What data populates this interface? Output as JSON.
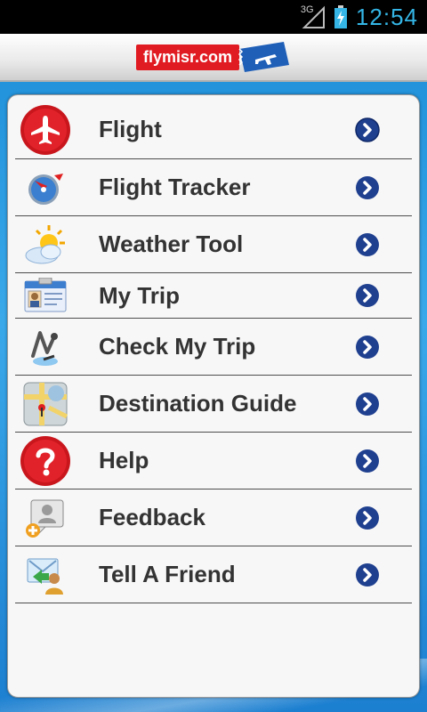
{
  "status_bar": {
    "network": "3G",
    "time": "12:54"
  },
  "header": {
    "logo_text": "flymisr.com"
  },
  "menu": {
    "items": [
      {
        "label": "Flight",
        "icon": "airplane-icon"
      },
      {
        "label": "Flight Tracker",
        "icon": "compass-icon"
      },
      {
        "label": "Weather Tool",
        "icon": "weather-icon"
      },
      {
        "label": "My Trip",
        "icon": "id-card-icon"
      },
      {
        "label": "Check My Trip",
        "icon": "route-pin-icon"
      },
      {
        "label": "Destination Guide",
        "icon": "map-icon"
      },
      {
        "label": "Help",
        "icon": "help-icon"
      },
      {
        "label": "Feedback",
        "icon": "feedback-icon"
      },
      {
        "label": "Tell A Friend",
        "icon": "tell-friend-icon"
      }
    ]
  },
  "colors": {
    "accent_blue": "#1b8bd6",
    "brand_red": "#e11b22",
    "status_blue": "#34b5e5",
    "arrow_navy": "#1f3f8f"
  }
}
